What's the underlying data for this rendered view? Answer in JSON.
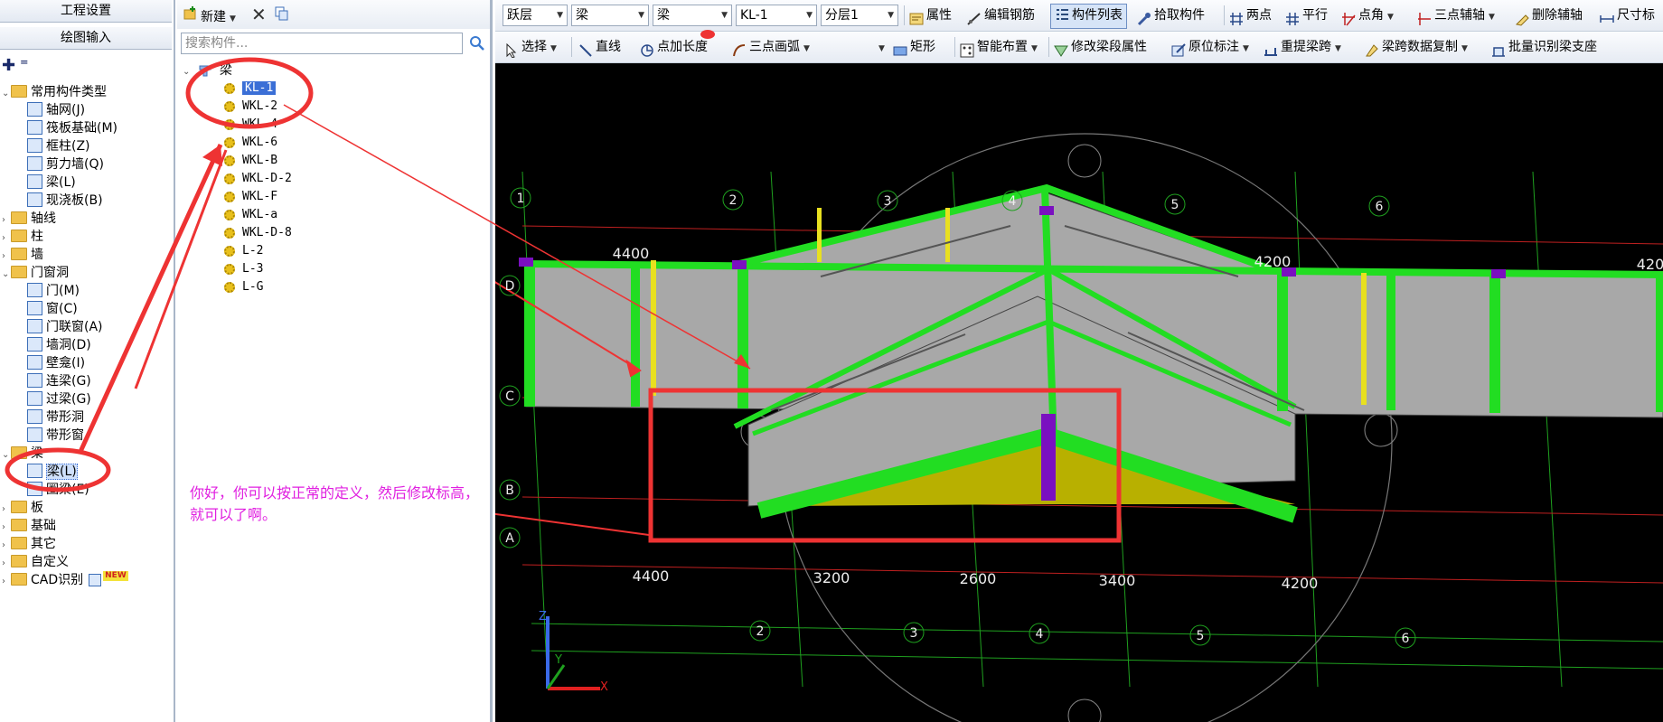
{
  "left_nav": {
    "project_settings": "工程设置",
    "drawing_input": "绘图输入",
    "tree": [
      {
        "label": "常用构件类型",
        "kind": "folder",
        "expanded": true
      },
      {
        "label": "轴网(J)",
        "kind": "item"
      },
      {
        "label": "筏板基础(M)",
        "kind": "item"
      },
      {
        "label": "框柱(Z)",
        "kind": "item"
      },
      {
        "label": "剪力墙(Q)",
        "kind": "item"
      },
      {
        "label": "梁(L)",
        "kind": "item"
      },
      {
        "label": "现浇板(B)",
        "kind": "item"
      },
      {
        "label": "轴线",
        "kind": "folder"
      },
      {
        "label": "柱",
        "kind": "folder"
      },
      {
        "label": "墙",
        "kind": "folder"
      },
      {
        "label": "门窗洞",
        "kind": "folder",
        "expanded": true
      },
      {
        "label": "门(M)",
        "kind": "item"
      },
      {
        "label": "窗(C)",
        "kind": "item"
      },
      {
        "label": "门联窗(A)",
        "kind": "item"
      },
      {
        "label": "墙洞(D)",
        "kind": "item"
      },
      {
        "label": "壁龛(I)",
        "kind": "item"
      },
      {
        "label": "连梁(G)",
        "kind": "item"
      },
      {
        "label": "过梁(G)",
        "kind": "item"
      },
      {
        "label": "带形洞",
        "kind": "item"
      },
      {
        "label": "带形窗",
        "kind": "item"
      },
      {
        "label": "梁",
        "kind": "folder",
        "expanded": true
      },
      {
        "label": "梁(L)",
        "kind": "item",
        "selected": true
      },
      {
        "label": "圈梁(E)",
        "kind": "item"
      },
      {
        "label": "板",
        "kind": "folder"
      },
      {
        "label": "基础",
        "kind": "folder"
      },
      {
        "label": "其它",
        "kind": "folder"
      },
      {
        "label": "自定义",
        "kind": "folder"
      },
      {
        "label": "CAD识别",
        "kind": "folder",
        "badge": "NEW"
      }
    ]
  },
  "mid_panel": {
    "new_label": "新建",
    "search_placeholder": "搜索构件...",
    "root": "梁",
    "components": [
      "KL-1",
      "WKL-2",
      "WKL-4",
      "WKL-6",
      "WKL-B",
      "WKL-D-2",
      "WKL-F",
      "WKL-a",
      "WKL-D-8",
      "L-2",
      "L-3",
      "L-G"
    ],
    "selected_component": "KL-1"
  },
  "toolbar1": {
    "floor": "跃层",
    "category": "梁",
    "type": "梁",
    "component": "KL-1",
    "layer": "分层1",
    "properties": "属性",
    "edit_rebar": "编辑钢筋",
    "component_list": "构件列表",
    "pick_component": "拾取构件",
    "two_points": "两点",
    "parallel": "平行",
    "point_angle": "点角",
    "three_point_aux": "三点辅轴",
    "delete_aux": "删除辅轴",
    "dim_label": "尺寸标"
  },
  "toolbar2": {
    "select": "选择",
    "line": "直线",
    "point_length": "点加长度",
    "three_point_arc": "三点画弧",
    "rectangle": "矩形",
    "smart_layout": "智能布置",
    "modify_segment": "修改梁段属性",
    "origin_mark": "原位标注",
    "re_span": "重提梁跨",
    "copy_span_data": "梁跨数据复制",
    "batch_identify": "批量识别梁支座"
  },
  "canvas": {
    "annotation_line1": "你好，你可以按正常的定义，然后修改标高，",
    "annotation_line2": "就可以了啊。",
    "top_axis_labels": [
      "1",
      "2",
      "3",
      "4",
      "5",
      "6"
    ],
    "bottom_axis_labels": [
      "2",
      "3",
      "4",
      "5",
      "6"
    ],
    "row_labels": [
      "D",
      "C",
      "B",
      "A"
    ],
    "top_dims": [
      "4400",
      "4200",
      "420"
    ],
    "bottom_dims": [
      "4400",
      "3200",
      "2600",
      "3400",
      "4200"
    ],
    "z_label": "Z",
    "y_label": "Y",
    "x_label": "X"
  },
  "colors": {
    "beam_green": "#22dd22",
    "wall_grey": "#a8a8a8",
    "column_purple": "#7a10c0",
    "highlight_red": "#ee3333",
    "annotation_magenta": "#e020e0",
    "slab_yellow": "#b8b000",
    "selection_blue": "#3b6fd6"
  }
}
